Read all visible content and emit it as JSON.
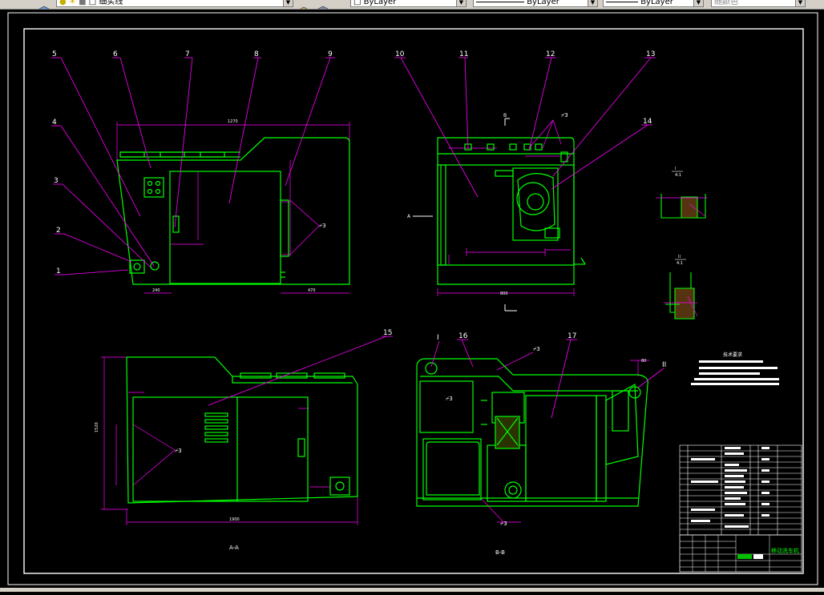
{
  "toolbar": {
    "layer_name": "细实线",
    "color_combo": "ByLayer",
    "linetype_combo": "ByLayer",
    "lineweight_combo": "ByLayer",
    "plotstyle_combo": "随颜色"
  },
  "drawing": {
    "balloons": [
      "1",
      "2",
      "3",
      "4",
      "5",
      "6",
      "7",
      "8",
      "9",
      "10",
      "11",
      "12",
      "13",
      "14",
      "15",
      "16",
      "17",
      "I",
      "II"
    ],
    "view_labels": {
      "view_aa": "A-A",
      "view_bb": "B-B",
      "arrow_a": "A",
      "arrow_b": "B"
    },
    "tech_req_title": "技术要求",
    "title_block_name": "移动洗车机",
    "dims": {
      "front_top": "1270",
      "front_bottom": "470",
      "front_left": "240",
      "side_bottom": "800",
      "aa_bottom": "1900",
      "aa_left": "1520",
      "bb_top": "80"
    }
  },
  "colors": {
    "drawing_line": "#00ff00",
    "dimension": "#ff00ff",
    "leader": "#ff00ff",
    "text": "#ffffff",
    "frame": "#ffffff",
    "background": "#000000"
  }
}
